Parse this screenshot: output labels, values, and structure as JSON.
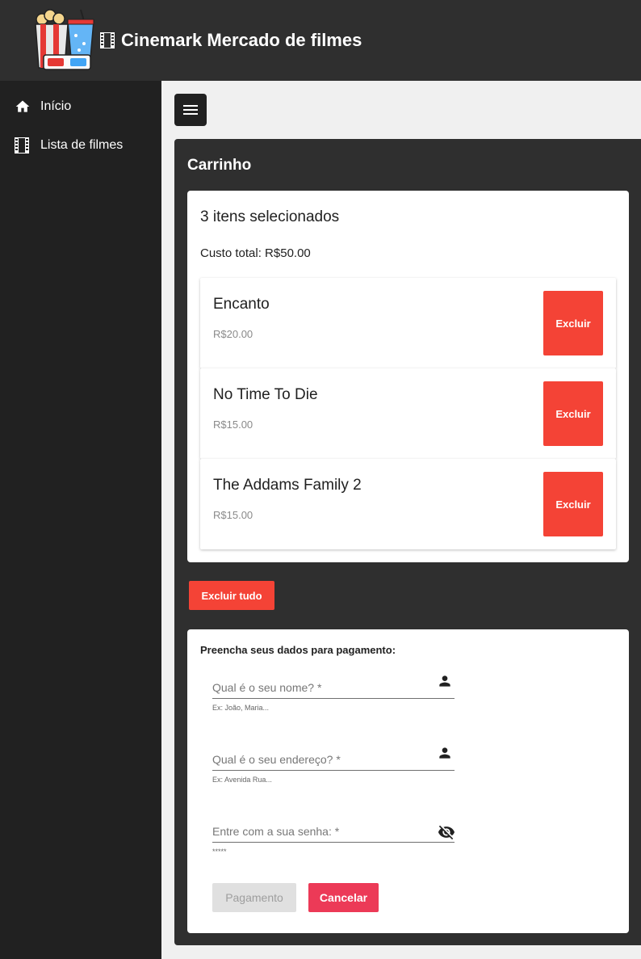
{
  "header": {
    "title": "Cinemark Mercado de filmes",
    "logo_icon": "popcorn-3d-glasses-logo",
    "title_icon": "film-icon"
  },
  "sidebar": {
    "items": [
      {
        "label": "Início",
        "icon": "home-icon"
      },
      {
        "label": "Lista de filmes",
        "icon": "film-icon"
      }
    ]
  },
  "toolbar": {
    "menu_icon": "hamburger-menu-icon"
  },
  "cart": {
    "title": "Carrinho",
    "count_text": "3 itens selecionados",
    "total_label": "Custo total:",
    "total_value": "R$50.00",
    "items": [
      {
        "name": "Encanto",
        "price": "R$20.00",
        "delete_label": "Excluir"
      },
      {
        "name": "No Time To Die",
        "price": "R$15.00",
        "delete_label": "Excluir"
      },
      {
        "name": "The Addams Family 2",
        "price": "R$15.00",
        "delete_label": "Excluir"
      }
    ],
    "delete_all_label": "Excluir tudo"
  },
  "payment_form": {
    "title": "Preencha seus dados para pagamento:",
    "name_field": {
      "label": "Qual é o seu nome? *",
      "hint": "Ex: João, Maria...",
      "icon": "person-icon"
    },
    "address_field": {
      "label": "Qual é o seu endereço? *",
      "hint": "Ex: Avenida Rua...",
      "icon": "person-icon"
    },
    "password_field": {
      "label": "Entre com a sua senha: *",
      "hint": "*****",
      "icon": "eye-off-icon"
    },
    "pay_label": "Pagamento",
    "cancel_label": "Cancelar"
  },
  "colors": {
    "topbar": "#2f2f2f",
    "sidebar": "#212121",
    "danger": "#f44336",
    "cancel": "#ec3a57",
    "disabled": "#e0e0e0"
  }
}
